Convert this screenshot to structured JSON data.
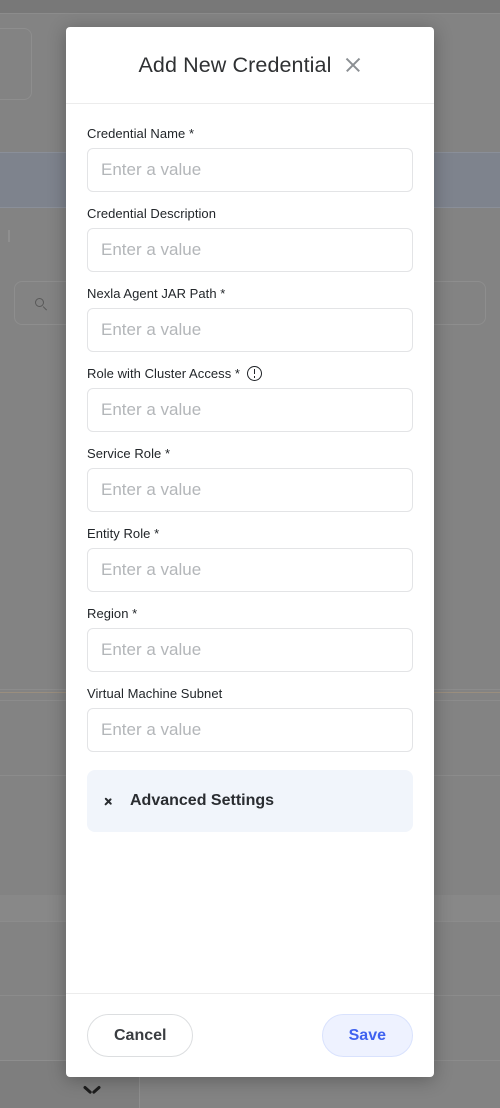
{
  "background": {
    "search_icon": "search-icon",
    "chevron_icon": "chevron-down-icon"
  },
  "modal": {
    "title": "Add New Credential",
    "close_icon": "close-icon",
    "fields": [
      {
        "label": "Credential Name *",
        "placeholder": "Enter a value",
        "value": "",
        "name": "credential-name",
        "info": false
      },
      {
        "label": "Credential Description",
        "placeholder": "Enter a value",
        "value": "",
        "name": "credential-description",
        "info": false
      },
      {
        "label": "Nexla Agent JAR Path *",
        "placeholder": "Enter a value",
        "value": "",
        "name": "nexla-agent-jar-path",
        "info": false
      },
      {
        "label": "Role with Cluster Access *",
        "placeholder": "Enter a value",
        "value": "",
        "name": "role-with-cluster-access",
        "info": true
      },
      {
        "label": "Service Role *",
        "placeholder": "Enter a value",
        "value": "",
        "name": "service-role",
        "info": false
      },
      {
        "label": "Entity Role *",
        "placeholder": "Enter a value",
        "value": "",
        "name": "entity-role",
        "info": false
      },
      {
        "label": "Region *",
        "placeholder": "Enter a value",
        "value": "",
        "name": "region",
        "info": false
      },
      {
        "label": "Virtual Machine Subnet",
        "placeholder": "Enter a value",
        "value": "",
        "name": "virtual-machine-subnet",
        "info": false
      }
    ],
    "advanced_settings": {
      "label": "Advanced Settings",
      "icon": "chevron-right-icon",
      "expanded": false
    },
    "footer": {
      "cancel_label": "Cancel",
      "save_label": "Save"
    }
  },
  "colors": {
    "accent": "#3f62f0",
    "accent_bg": "#eef2ff",
    "advanced_bg": "#f1f5fb",
    "backdrop": "#838383",
    "input_border": "#e3e4e6",
    "placeholder": "#b3b6b9"
  }
}
